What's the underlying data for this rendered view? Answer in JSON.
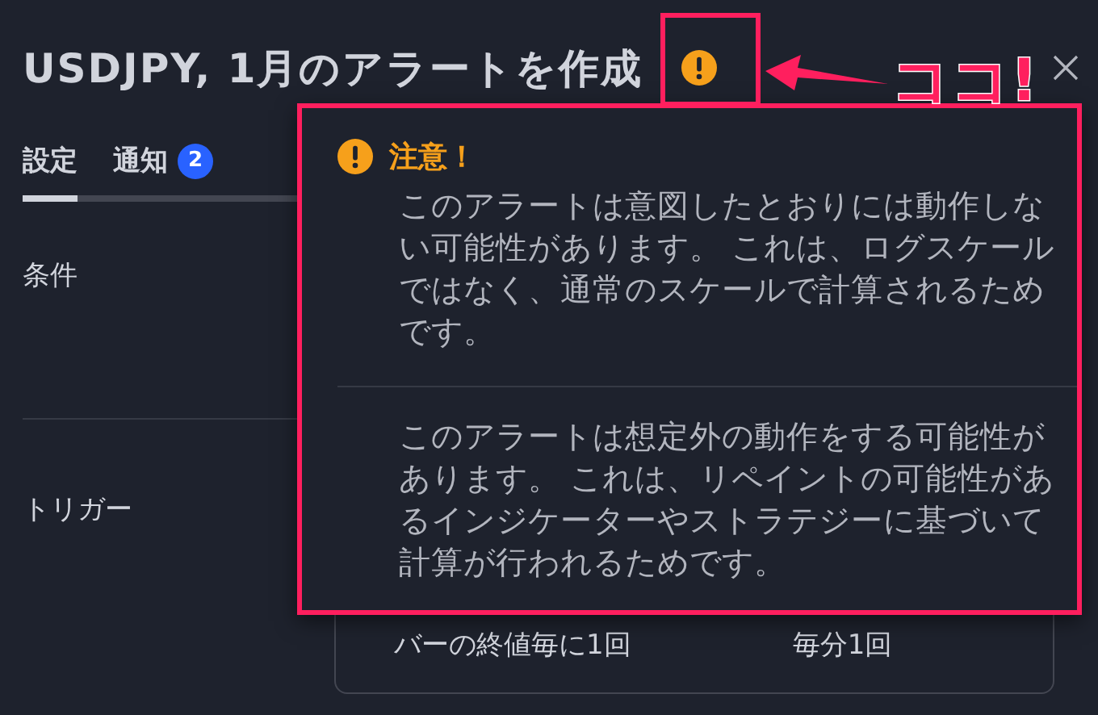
{
  "dialog": {
    "title": "USDJPY, 1月のアラートを作成"
  },
  "tabs": [
    {
      "label": "設定",
      "selected": true
    },
    {
      "label": "通知",
      "selected": false,
      "badge": "2"
    }
  ],
  "rows": [
    {
      "label": "条件"
    },
    {
      "label": "トリガー",
      "options": [
        "バーの終値毎に1回",
        "毎分1回"
      ]
    }
  ],
  "popover": {
    "heading": "注意！",
    "paragraphs": [
      "このアラートは意図したとおりには動作しない可能性があります。 これは、ログスケールではなく、通常のスケールで計算されるためです。",
      "このアラートは想定外の動作をする可能性があります。 これは、リペイントの可能性があるインジケーターやストラテジーに基づいて計算が行われるためです。"
    ]
  },
  "annotation": {
    "label": "ココ!"
  }
}
